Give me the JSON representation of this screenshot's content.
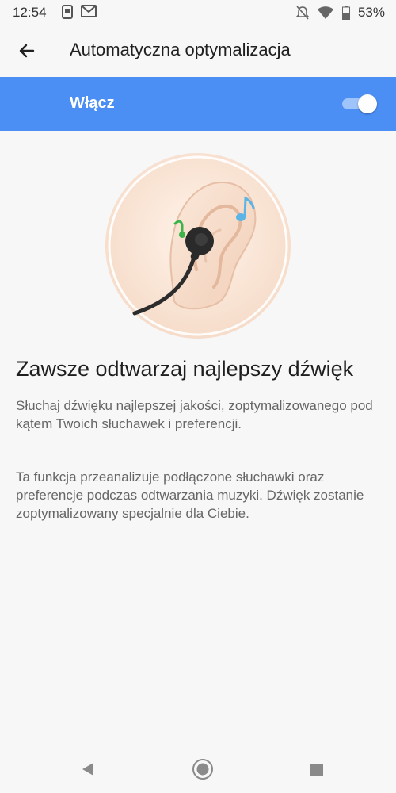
{
  "status_bar": {
    "time": "12:54",
    "battery": "53%",
    "icons": [
      "screenshot-icon",
      "gmail-icon",
      "mute-icon",
      "wifi-icon",
      "battery-icon"
    ]
  },
  "app_bar": {
    "title": "Automatyczna optymalizacja",
    "back_icon": "arrow-back-icon"
  },
  "toggle_row": {
    "label": "Włącz",
    "enabled": true,
    "background": "#4b8ff5"
  },
  "content": {
    "headline": "Zawsze odtwarzaj najlepszy dźwięk",
    "paragraph_1": "Słuchaj dźwięku najlepszej jakości, zoptymalizowanego pod kątem Twoich słuchawek i preferencji.",
    "paragraph_2": "Ta funkcja przeanalizuje podłączone słuchawki oraz preferencje podczas odtwarzania muzyki. Dźwięk zostanie zoptymalizowany specjalnie dla Ciebie."
  },
  "nav_bar": {
    "icons": [
      "nav-back-icon",
      "nav-home-icon",
      "nav-recents-icon"
    ]
  }
}
